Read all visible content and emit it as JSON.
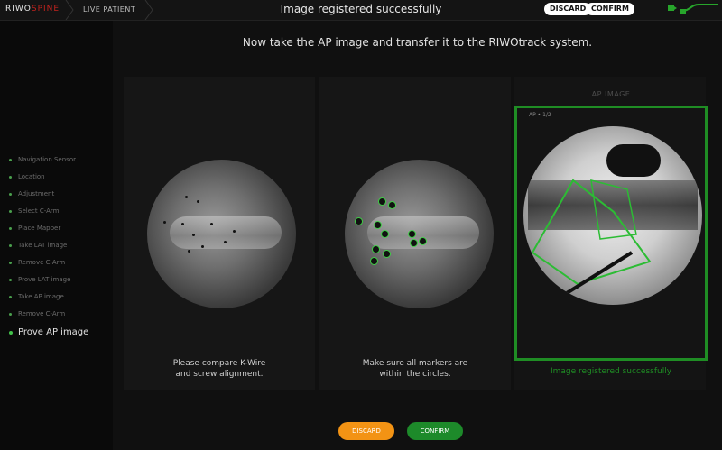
{
  "header": {
    "logo_text": "RIWO",
    "logo_suffix": "SPINE",
    "patient_mode": "LIVE PATIENT",
    "title": "Image registered successfully",
    "discard": "DISCARD",
    "confirm": "CONFIRM"
  },
  "sidebar": {
    "steps": [
      {
        "label": "Navigation Sensor"
      },
      {
        "label": "Location"
      },
      {
        "label": "Adjustment"
      },
      {
        "label": "Select C-Arm"
      },
      {
        "label": "Place Mapper"
      },
      {
        "label": "Take LAT image"
      },
      {
        "label": "Remove C-Arm"
      },
      {
        "label": "Prove LAT image"
      },
      {
        "label": "Take AP image"
      },
      {
        "label": "Remove C-Arm"
      },
      {
        "label": "Prove AP image",
        "active": true
      }
    ]
  },
  "main": {
    "instruction": "Now take the AP image and transfer it to the RIWOtrack system.",
    "panels": [
      {
        "caption_line1": "Please compare K-Wire",
        "caption_line2": "and screw alignment."
      },
      {
        "caption_line1": "Make sure all markers are",
        "caption_line2": "within the circles."
      },
      {
        "title": "AP IMAGE",
        "sub": "AP • 1/2",
        "status": "Image registered successfully"
      }
    ],
    "discard_button": "DISCARD",
    "confirm_button": "CONFIRM"
  },
  "colors": {
    "accent_green": "#1f8d24",
    "discard_orange": "#f39314",
    "confirm_green": "#1d8a2a"
  }
}
